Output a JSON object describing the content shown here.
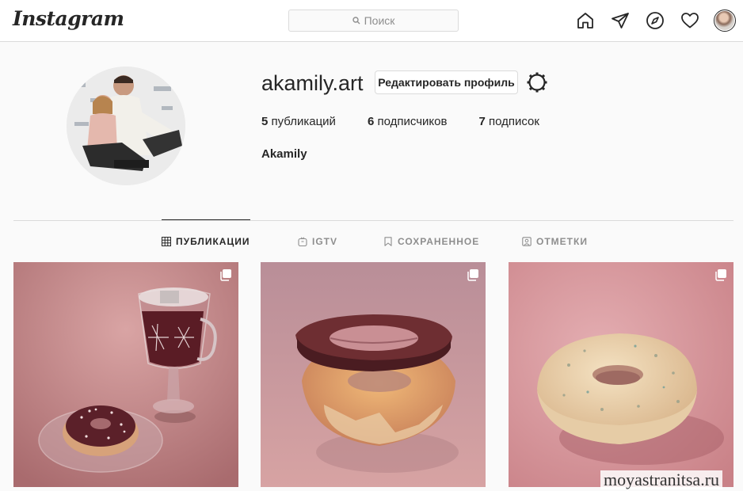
{
  "app": {
    "logo": "Instagram"
  },
  "search": {
    "placeholder": "Поиск"
  },
  "nav": {
    "icons": [
      "home-icon",
      "direct-icon",
      "explore-icon",
      "heart-icon",
      "profile-avatar"
    ]
  },
  "profile": {
    "username": "akamily.art",
    "edit_label": "Редактировать профиль",
    "stats": [
      {
        "count": "5",
        "label": "публикаций"
      },
      {
        "count": "6",
        "label": "подписчиков"
      },
      {
        "count": "7",
        "label": "подписок"
      }
    ],
    "full_name": "Akamily"
  },
  "tabs": [
    {
      "label": "ПУБЛИКАЦИИ",
      "icon": "grid-icon",
      "active": true
    },
    {
      "label": "IGTV",
      "icon": "igtv-icon",
      "active": false
    },
    {
      "label": "СОХРАНЕННОЕ",
      "icon": "bookmark-icon",
      "active": false
    },
    {
      "label": "ОТМЕТКИ",
      "icon": "tag-icon",
      "active": false
    }
  ],
  "posts": [
    {
      "subject": "donut with mug",
      "multi": true
    },
    {
      "subject": "floating glaze donut",
      "multi": true
    },
    {
      "subject": "sprinkled donut",
      "multi": true
    }
  ],
  "colors": {
    "accent": "#262626",
    "border": "#dbdbdb",
    "post_bg": "#c98e8f"
  },
  "watermark": "moyastranitsa.ru"
}
